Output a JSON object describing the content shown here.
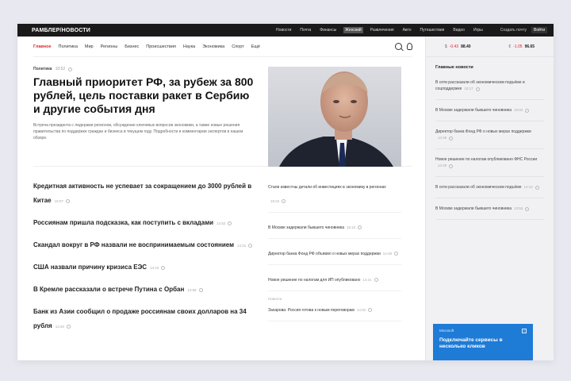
{
  "topbar": {
    "brand": "РАМБЛЕР/НОВОСТИ",
    "nav": [
      "Новости",
      "Почта",
      "Финансы",
      "Женский",
      "Развлечения",
      "Авто",
      "Путешествия",
      "Видео",
      "Игры"
    ],
    "active_nav": 3,
    "right": [
      "Создать почту",
      "Войти"
    ]
  },
  "secnav": {
    "items": [
      "Главное",
      "Политика",
      "Мир",
      "Регионы",
      "Бизнес",
      "Происшествия",
      "Наука",
      "Экономика",
      "Спорт",
      "Ещё"
    ],
    "active": 0
  },
  "hero": {
    "category": "Политика",
    "time": "10:52",
    "title": "Главный приоритет РФ, за рубеж за 800 рублей, цель поставки ракет в Сербию и другие события дня",
    "lead": "Встреча президента с лидерами регионов, обсуждение ключевых вопросов экономики, а также новые решения правительства по поддержке граждан и бизнеса в текущем году. Подробности и комментарии экспертов в нашем обзоре."
  },
  "left_news": [
    {
      "title": "Кредитная активность не успевает за сокращением до 3000 рублей в Китае",
      "time": "15:07"
    },
    {
      "title": "Россиянам пришла подсказка, как поступить с вкладами",
      "time": "14:52"
    },
    {
      "title": "Скандал вокруг в РФ назвали не воспринимаемым состоянием",
      "time": "14:31"
    },
    {
      "title": "США назвали причину кризиса ЕЭС",
      "time": "14:10"
    },
    {
      "title": "В Кремле рассказали о встрече Путина с Орбан",
      "time": "13:58"
    },
    {
      "title": "Банк из Азии сообщил о продаже россиянам своих долларов на 34 рубля",
      "time": "13:40"
    }
  ],
  "right_news": [
    {
      "title": "Стали известны детали об инвестициях в экономику в регионах",
      "time": "15:22"
    },
    {
      "title": "В Москве задержали бывшего чиновника",
      "time": "15:10"
    },
    {
      "title": "Директор банка Фонд РФ объявил о новых мерах поддержки",
      "time": "14:48"
    },
    {
      "title": "Новое решение по налогам для ИП опубликовано",
      "time": "14:21"
    },
    {
      "pre": "Новости",
      "title": "Захарова: Россия готова к новым переговорам",
      "time": "14:02"
    }
  ],
  "rates": [
    {
      "sym": "$",
      "chg": "-0.43",
      "val": "88.40"
    },
    {
      "sym": "€",
      "chg": "-1.05",
      "val": "96.65"
    }
  ],
  "sidebar": {
    "heading": "Главные новости",
    "items": [
      {
        "title": "В сети рассказали об экономическом подъёме и соцподдержке",
        "time": "15:17"
      },
      {
        "title": "В Москве задержали бывшего чиновника",
        "time": "15:02"
      },
      {
        "title": "Директор банка Фонд РФ о новых мерах поддержки",
        "time": "14:45"
      },
      {
        "title": "Новое решение по налогам опубликовано ФНС России",
        "time": "14:30"
      },
      {
        "title": "В сети рассказали об экономическом подъёме",
        "time": "14:12"
      },
      {
        "title": "В Москве задержали бывшего чиновника",
        "time": "13:55"
      }
    ]
  },
  "ad": {
    "brand": "Microsoft",
    "title": "Подключайте сервисы в несколько кликов"
  }
}
